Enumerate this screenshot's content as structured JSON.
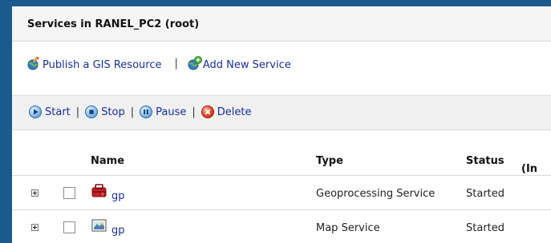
{
  "header": {
    "title": "Services in RANEL_PC2 (root)"
  },
  "actions": {
    "publish_label": "Publish a GIS Resource",
    "separator": "|",
    "add_label": "Add New Service"
  },
  "toolbar": {
    "start_label": "Start",
    "stop_label": "Stop",
    "pause_label": "Pause",
    "delete_label": "Delete",
    "separator": "|"
  },
  "table": {
    "columns": {
      "name": "Name",
      "type": "Type",
      "status": "Status",
      "extra": "(In"
    },
    "rows": [
      {
        "name": "gp",
        "type": "Geoprocessing Service",
        "status": "Started",
        "icon": "toolbox-icon"
      },
      {
        "name": "gp",
        "type": "Map Service",
        "status": "Started",
        "icon": "map-icon"
      }
    ]
  },
  "colors": {
    "background": "#1a5a8c",
    "link": "#1a2f9a",
    "header_bg": "#f5f5f5",
    "toolbar_bg": "#f0f0f0"
  }
}
